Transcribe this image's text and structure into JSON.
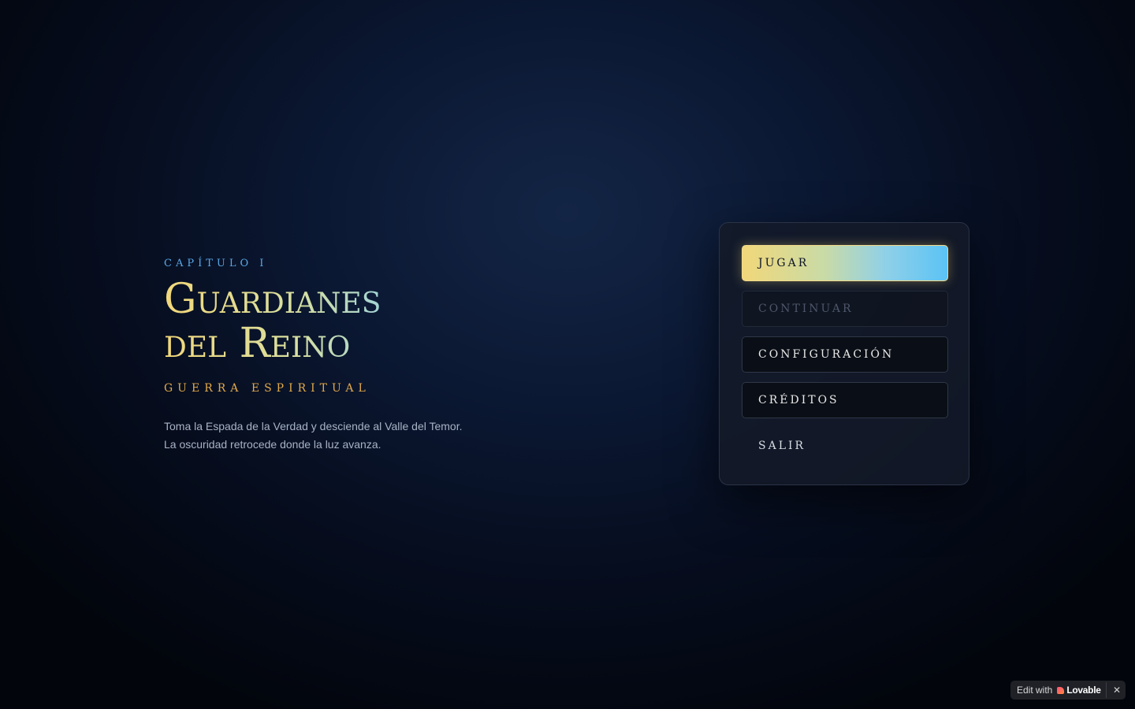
{
  "hero": {
    "chapter": "CAPÍTULO I",
    "title": "Guardianes\ndel Reino",
    "subtitle": "GUERRA ESPIRITUAL",
    "description": "Toma la Espada de la Verdad y desciende al Valle del Temor. La oscuridad retrocede donde la luz avanza."
  },
  "menu": {
    "play": "JUGAR",
    "continue": "CONTINUAR",
    "settings": "CONFIGURACIÓN",
    "credits": "CRÉDITOS",
    "exit": "SALIR"
  },
  "badge": {
    "edit_label": "Edit with",
    "brand": "Lovable",
    "close": "✕"
  },
  "colors": {
    "accent_gold": "#f1d77a",
    "accent_blue": "#5bc3f5",
    "subtitle_orange": "#e2a94c",
    "chapter_blue": "#5aa8e6"
  }
}
